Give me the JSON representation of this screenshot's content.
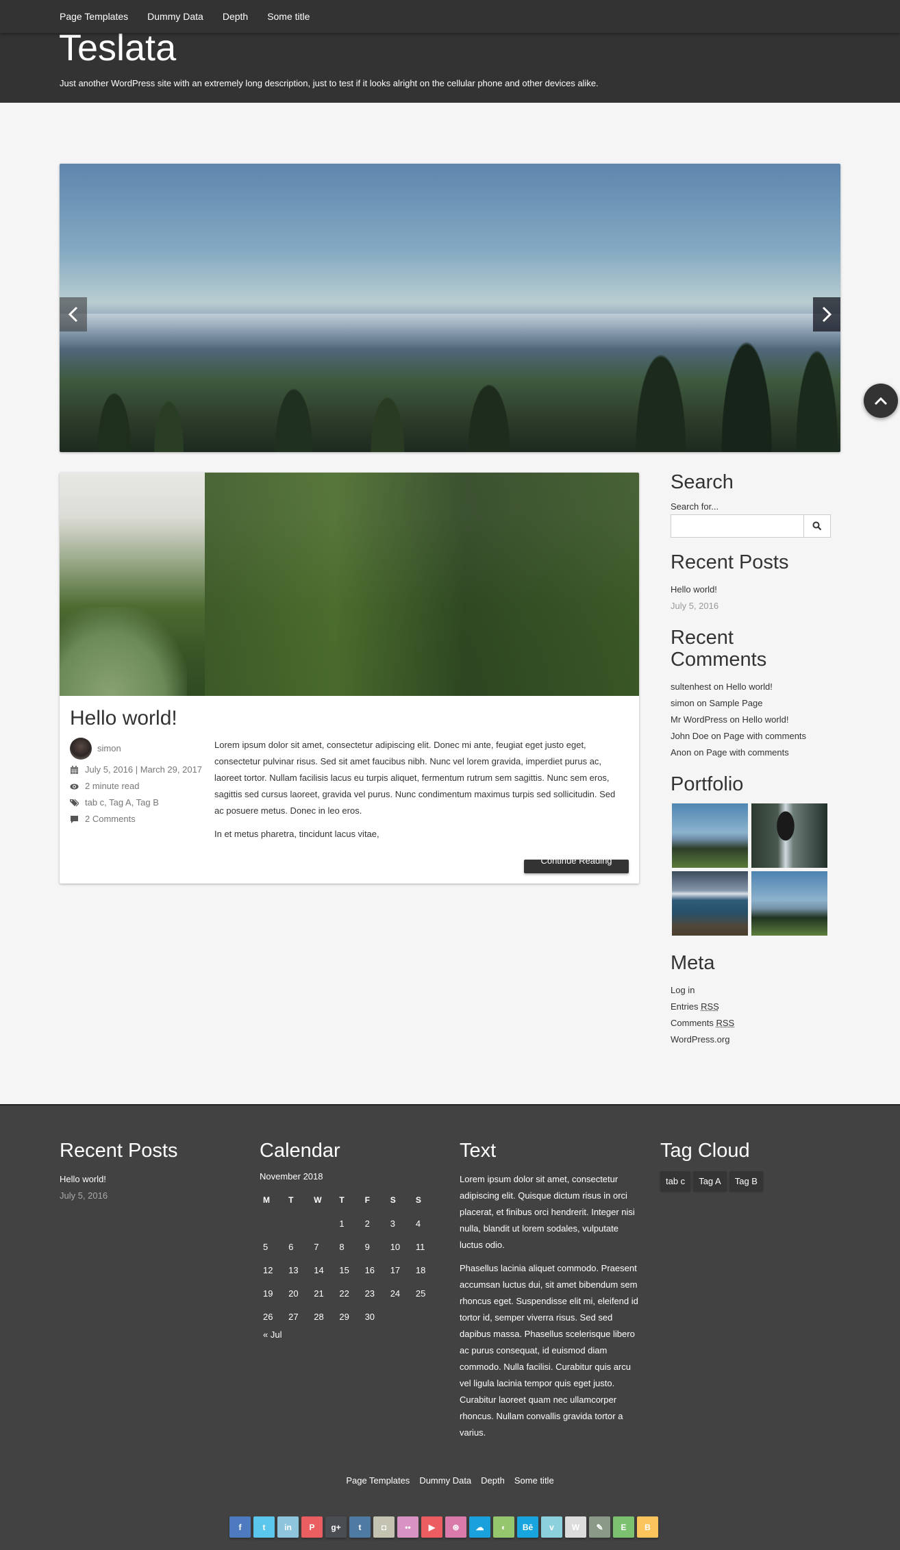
{
  "nav": {
    "items": [
      "Page Templates",
      "Dummy Data",
      "Depth",
      "Some title"
    ]
  },
  "header": {
    "title": "Teslata",
    "description": "Just another WordPress site with an extremely long description, just to test if it looks alright on the cellular phone and other devices alike."
  },
  "slider": {
    "prev_icon": "chevron-left-icon",
    "next_icon": "chevron-right-icon"
  },
  "back_to_top": {
    "icon": "chevron-up-icon"
  },
  "post": {
    "title": "Hello world!",
    "author": "simon",
    "date": "July 5, 2016 | March 29, 2017",
    "read_time": "2 minute read",
    "tags": "tab c, Tag A, Tag B",
    "comments": "2 Comments",
    "paragraphs": [
      "Lorem ipsum dolor sit amet, consectetur adipiscing elit. Donec mi ante, feugiat eget justo eget, consectetur pulvinar risus. Sed sit amet faucibus nibh. Nunc vel lorem gravida, imperdiet purus ac, laoreet tortor. Nullam facilisis lacus eu turpis aliquet, fermentum rutrum sem sagittis. Nunc sem eros, sagittis sed cursus laoreet, gravida vel purus. Nunc condimentum maximus turpis sed sollicitudin. Sed ac posuere metus. Donec in leo eros.",
      "In et metus pharetra, tincidunt lacus vitae,"
    ],
    "continue_label": "Continue Reading"
  },
  "sidebar": {
    "search": {
      "title": "Search",
      "label": "Search for...",
      "value": "",
      "placeholder": ""
    },
    "recent_posts": {
      "title": "Recent Posts",
      "items": [
        {
          "title": "Hello world!",
          "date": "July 5, 2016"
        }
      ]
    },
    "recent_comments": {
      "title": "Recent Comments",
      "items": [
        {
          "author": "sultenhest",
          "on": "on",
          "post": "Hello world!"
        },
        {
          "author": "simon",
          "on": "on",
          "post": "Sample Page"
        },
        {
          "author": "Mr WordPress",
          "on": "on",
          "post": "Hello world!"
        },
        {
          "author": "John Doe",
          "on": "on",
          "post": "Page with comments"
        },
        {
          "author": "Anon",
          "on": "on",
          "post": "Page with comments"
        }
      ]
    },
    "portfolio": {
      "title": "Portfolio",
      "images": [
        "people-on-hill",
        "waterfall-hiker",
        "coastal-cliffs",
        "forest-meadow"
      ]
    },
    "meta": {
      "title": "Meta",
      "login": "Log in",
      "entries_prefix": "Entries",
      "comments_prefix": "Comments",
      "rss": "RSS",
      "wordpress": "WordPress.org"
    }
  },
  "footer": {
    "recent_posts": {
      "title": "Recent Posts",
      "items": [
        {
          "title": "Hello world!",
          "date": "July 5, 2016"
        }
      ]
    },
    "calendar": {
      "title": "Calendar",
      "caption": "November 2018",
      "weekdays": [
        "M",
        "T",
        "W",
        "T",
        "F",
        "S",
        "S"
      ],
      "weeks": [
        [
          "",
          "",
          "",
          "1",
          "2",
          "3",
          "4"
        ],
        [
          "5",
          "6",
          "7",
          "8",
          "9",
          "10",
          "11"
        ],
        [
          "12",
          "13",
          "14",
          "15",
          "16",
          "17",
          "18"
        ],
        [
          "19",
          "20",
          "21",
          "22",
          "23",
          "24",
          "25"
        ],
        [
          "26",
          "27",
          "28",
          "29",
          "30",
          "",
          ""
        ]
      ],
      "prev_link": "« Jul"
    },
    "text": {
      "title": "Text",
      "paragraphs": [
        "Lorem ipsum dolor sit amet, consectetur adipiscing elit. Quisque dictum risus in orci placerat, et finibus orci hendrerit. Integer nisi nulla, blandit ut lorem sodales, vulputate luctus odio.",
        "Phasellus lacinia aliquet commodo. Praesent accumsan luctus dui, sit amet bibendum sem rhoncus eget. Suspendisse elit mi, eleifend id tortor id, semper viverra risus. Sed sed dapibus massa. Phasellus scelerisque libero ac purus consequat, id euismod diam commodo. Nulla facilisi. Curabitur quis arcu vel ligula lacinia tempor quis eget justo. Curabitur laoreet quam nec ullamcorper rhoncus. Nullam convallis gravida tortor a varius."
      ]
    },
    "tag_cloud": {
      "title": "Tag Cloud",
      "tags": [
        "tab c",
        "Tag A",
        "Tag B"
      ]
    },
    "nav": [
      "Page Templates",
      "Dummy Data",
      "Depth",
      "Some title"
    ],
    "social": [
      {
        "name": "facebook",
        "glyph": "f",
        "color": "#4e7bbf"
      },
      {
        "name": "twitter",
        "glyph": "t",
        "color": "#5bc6ec"
      },
      {
        "name": "linkedin",
        "glyph": "in",
        "color": "#8ec5dc"
      },
      {
        "name": "pinterest",
        "glyph": "P",
        "color": "#ea5e62"
      },
      {
        "name": "google-plus",
        "glyph": "g+",
        "color": "#4a4d52"
      },
      {
        "name": "tumblr",
        "glyph": "t",
        "color": "#4f7aa2"
      },
      {
        "name": "instagram",
        "glyph": "◘",
        "color": "#c4c3b1"
      },
      {
        "name": "flickr",
        "glyph": "••",
        "color": "#d893c3"
      },
      {
        "name": "youtube",
        "glyph": "▶",
        "color": "#ec5d62"
      },
      {
        "name": "dribbble",
        "glyph": "⊛",
        "color": "#d97aaa"
      },
      {
        "name": "soundcloud",
        "glyph": "☁",
        "color": "#1aa1dc"
      },
      {
        "name": "envato",
        "glyph": "◐",
        "color": "#95c56c"
      },
      {
        "name": "behance",
        "glyph": "Bē",
        "color": "#18a5dd"
      },
      {
        "name": "vimeo",
        "glyph": "v",
        "color": "#8cd0dd"
      },
      {
        "name": "wordpress",
        "glyph": "W",
        "color": "#dcdcdc"
      },
      {
        "name": "delicious",
        "glyph": "✎",
        "color": "#8b9a88"
      },
      {
        "name": "evernote",
        "glyph": "E",
        "color": "#7cc16f"
      },
      {
        "name": "blogger",
        "glyph": "B",
        "color": "#fcc45c"
      }
    ]
  }
}
